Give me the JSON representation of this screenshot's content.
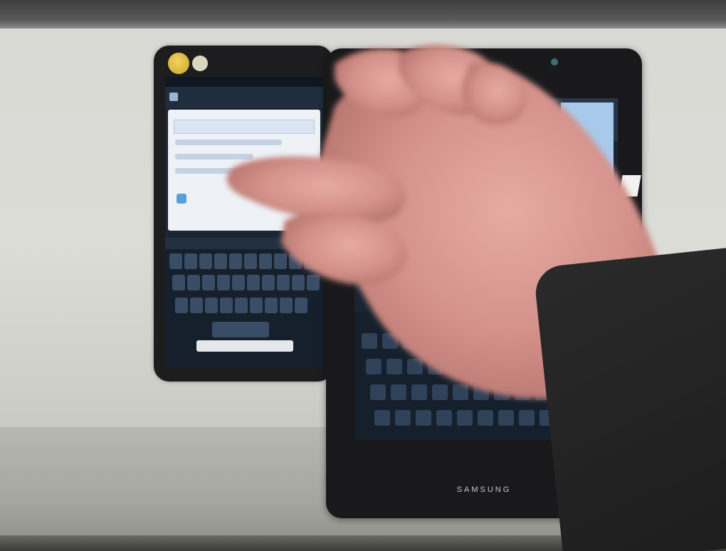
{
  "scene": {
    "description_tags": [
      "hand",
      "phone",
      "tablet"
    ],
    "colors": {
      "wall": "#dcdcd7",
      "device_body": "#1d1d20",
      "skin": "#d89a92"
    }
  },
  "tablet": {
    "brand": "SAMSUNG"
  },
  "icons": [
    "avatar-icon",
    "chat-bubble-icon",
    "camera-icon"
  ]
}
